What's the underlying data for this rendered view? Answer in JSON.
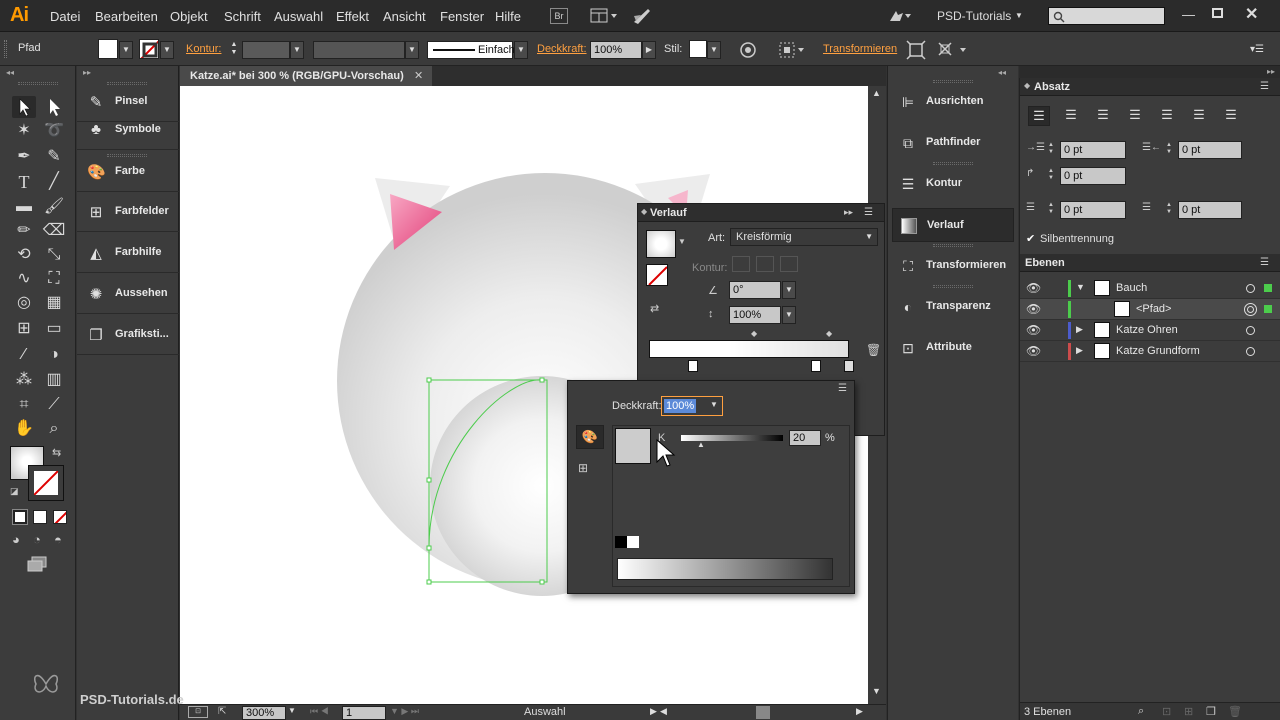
{
  "app": {
    "logo": "Ai"
  },
  "menu": [
    "Datei",
    "Bearbeiten",
    "Objekt",
    "Schrift",
    "Auswahl",
    "Effekt",
    "Ansicht",
    "Fenster",
    "Hilfe"
  ],
  "menubar": {
    "br_label": "Br",
    "workspace": "PSD-Tutorials",
    "search_placeholder": ""
  },
  "controlbar": {
    "selection_type": "Pfad",
    "kontur_label": "Kontur:",
    "stroke_profile": "Einfach",
    "deckkraft_label": "Deckkraft:",
    "deckkraft_value": "100%",
    "stil_label": "Stil:",
    "transformieren": "Transformieren"
  },
  "left_dock": [
    {
      "label": "Pinsel",
      "icon": "brush-icon"
    },
    {
      "label": "Symbole",
      "icon": "club-icon"
    },
    {
      "label": "Farbe",
      "icon": "palette-icon"
    },
    {
      "label": "Farbfelder",
      "icon": "grid-icon"
    },
    {
      "label": "Farbhilfe",
      "icon": "color-guide-icon"
    },
    {
      "label": "Aussehen",
      "icon": "sun-icon"
    },
    {
      "label": "Grafiksti...",
      "icon": "graphic-style-icon"
    }
  ],
  "document": {
    "tab_title": "Katze.ai* bei 300 % (RGB/GPU-Vorschau)",
    "zoom": "300%",
    "page": "1",
    "status": "Auswahl"
  },
  "right_dock": [
    {
      "label": "Ausrichten",
      "icon": "align-icon"
    },
    {
      "label": "Pathfinder",
      "icon": "pathfinder-icon"
    },
    {
      "label": "Kontur",
      "icon": "stroke-icon"
    },
    {
      "label": "Verlauf",
      "icon": "gradient-icon",
      "active": true
    },
    {
      "label": "Transformieren",
      "icon": "transform-icon"
    },
    {
      "label": "Transparenz",
      "icon": "transparency-icon"
    },
    {
      "label": "Attribute",
      "icon": "attributes-icon"
    }
  ],
  "verlauf": {
    "title": "Verlauf",
    "art_label": "Art:",
    "art_value": "Kreisförmig",
    "kontur_label": "Kontur:",
    "angle": "0°",
    "aspect": "100%"
  },
  "farbe_popup": {
    "deckkraft_label": "Deckkraft:",
    "deckkraft_value": "100%",
    "k_label": "K",
    "k_value": "20",
    "percent": "%"
  },
  "absatz": {
    "title": "Absatz",
    "fields": [
      "0 pt",
      "0 pt",
      "0 pt",
      "0 pt",
      "0 pt"
    ],
    "silbentrennung": "Silbentrennung"
  },
  "ebenen": {
    "title": "Ebenen",
    "layers": [
      {
        "name": "Bauch",
        "color": "#4ccc4c",
        "expanded": true
      },
      {
        "name": "<Pfad>",
        "color": "#4ccc4c",
        "sub": true
      },
      {
        "name": "Katze Ohren",
        "color": "#4c5ccc"
      },
      {
        "name": "Katze Grundform",
        "color": "#cc4c4c"
      }
    ],
    "count": "3 Ebenen"
  },
  "watermark": "PSD-Tutorials.de",
  "colors": {
    "accent_orange": "#ff9a00",
    "selection_green": "#4ccc4c",
    "ear_pink": "#e8407a"
  }
}
